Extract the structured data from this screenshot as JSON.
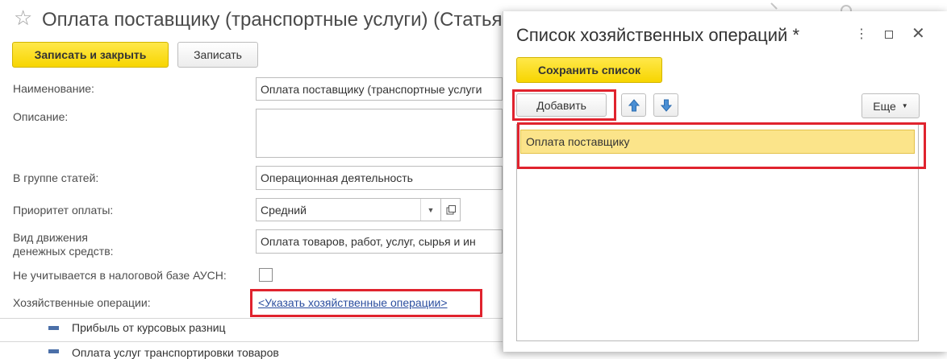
{
  "form": {
    "title": "Оплата поставщику (транспортные услуги) (Статья",
    "star_icon": "star-outline-icon",
    "buttons": {
      "save_close": "Записать и закрыть",
      "save": "Записать"
    },
    "fields": {
      "name_label": "Наименование:",
      "name_value": "Оплата поставщику (транспортные услуги",
      "description_label": "Описание:",
      "description_value": "",
      "group_label": "В группе статей:",
      "group_value": "Операционная деятельность",
      "priority_label": "Приоритет оплаты:",
      "priority_value": "Средний",
      "cashflow_label_line1": "Вид движения",
      "cashflow_label_line2": "денежных средств:",
      "cashflow_value": "Оплата товаров, работ, услуг, сырья и ин",
      "tax_label": "Не учитывается в налоговой базе АУСН:",
      "tax_checked": false,
      "operations_label": "Хозяйственные операции:",
      "operations_link": "<Указать хозяйственные операции>"
    },
    "tree": {
      "row1": "Прибыль от курсовых разниц",
      "row2": "Оплата услуг транспортировки товаров"
    }
  },
  "popup": {
    "title": "Список хозяйственных операций *",
    "controls": {
      "menu_icon": "more-vertical-icon",
      "maximize_icon": "maximize-icon",
      "close_icon": "close-icon"
    },
    "save_list_label": "Сохранить список",
    "add_label": "Добавить",
    "more_label": "Еще",
    "items": [
      "Оплата поставщику"
    ]
  },
  "colors": {
    "accent_yellow": "#f7d500",
    "highlight_red": "#e0232e",
    "link_blue": "#2b4e9f",
    "row_selected": "#fbe48a"
  }
}
